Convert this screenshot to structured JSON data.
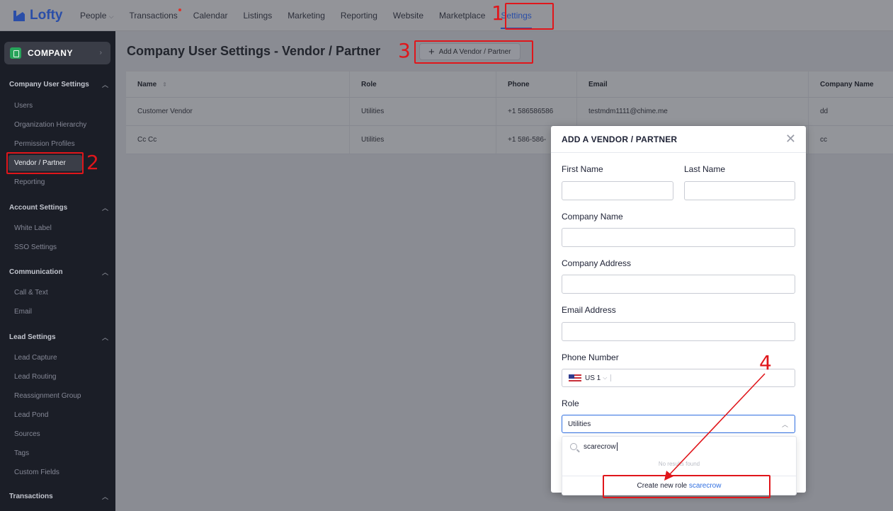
{
  "app": {
    "brand": "Lofty",
    "brand_color": "#2a4ea8"
  },
  "topnav": {
    "items": [
      "People",
      "Transactions",
      "Calendar",
      "Listings",
      "Marketing",
      "Reporting",
      "Website",
      "Marketplace",
      "Settings"
    ],
    "active": "Settings"
  },
  "sidebar": {
    "company_label": "COMPANY",
    "groups": [
      {
        "title": "Company User Settings",
        "items": [
          "Users",
          "Organization Hierarchy",
          "Permission Profiles",
          "Vendor / Partner",
          "Reporting"
        ]
      },
      {
        "title": "Account Settings",
        "items": [
          "White Label",
          "SSO Settings"
        ]
      },
      {
        "title": "Communication",
        "items": [
          "Call & Text",
          "Email"
        ]
      },
      {
        "title": "Lead Settings",
        "items": [
          "Lead Capture",
          "Lead Routing",
          "Reassignment Group",
          "Lead Pond",
          "Sources",
          "Tags",
          "Custom Fields"
        ]
      },
      {
        "title": "Transactions",
        "items": []
      }
    ],
    "active_item": "Vendor / Partner"
  },
  "main": {
    "title": "Company User Settings - Vendor / Partner",
    "add_button": "Add A Vendor / Partner",
    "table": {
      "columns": [
        "Name",
        "Role",
        "Phone",
        "Email",
        "Company Name"
      ],
      "rows": [
        [
          "Customer Vendor",
          "Utilities",
          "+1 586586586",
          "testmdm1111@chime.me",
          "dd"
        ],
        [
          "Cc Cc",
          "Utilities",
          "+1 586-586-",
          "",
          "cc"
        ]
      ]
    }
  },
  "modal": {
    "title": "ADD A VENDOR / PARTNER",
    "first_name_label": "First Name",
    "last_name_label": "Last Name",
    "company_name_label": "Company Name",
    "company_address_label": "Company Address",
    "email_label": "Email Address",
    "phone_label": "Phone Number",
    "phone_country": "US 1",
    "role_label": "Role",
    "role_value": "Utilities",
    "dropdown": {
      "search_value": "scarecrow",
      "empty_text": "No results found",
      "create_prefix": "Create new role",
      "create_term": "scarecrow"
    }
  },
  "annotations": [
    "1",
    "2",
    "3",
    "4"
  ],
  "annotation_color": "#e0161b"
}
